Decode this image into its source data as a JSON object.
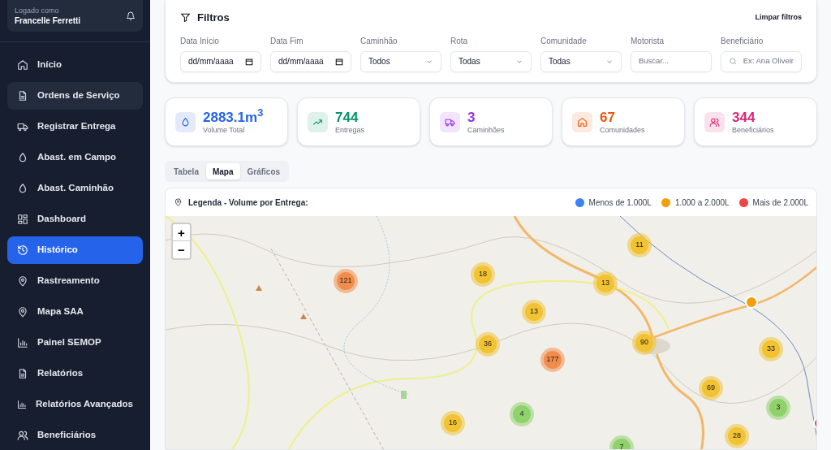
{
  "user": {
    "caption": "Logado como",
    "name": "Francelle Ferretti"
  },
  "nav": [
    {
      "label": "Início",
      "selected": false
    },
    {
      "label": "Ordens de Serviço",
      "selected": false,
      "hover": true
    },
    {
      "label": "Registrar Entrega",
      "selected": false
    },
    {
      "label": "Abast. em Campo",
      "selected": false
    },
    {
      "label": "Abast. Caminhão",
      "selected": false
    },
    {
      "label": "Dashboard",
      "selected": false
    },
    {
      "label": "Histórico",
      "selected": true
    },
    {
      "label": "Rastreamento",
      "selected": false
    },
    {
      "label": "Mapa SAA",
      "selected": false
    },
    {
      "label": "Painel SEMOP",
      "selected": false
    },
    {
      "label": "Relatórios",
      "selected": false
    },
    {
      "label": "Relatórios Avançados",
      "selected": false
    },
    {
      "label": "Beneficiários",
      "selected": false
    }
  ],
  "filters": {
    "title": "Filtros",
    "clear": "Limpar filtros",
    "fields": [
      {
        "label": "Data Início",
        "kind": "date",
        "value": "dd/mm/aaaa"
      },
      {
        "label": "Data Fim",
        "kind": "date",
        "value": "dd/mm/aaaa"
      },
      {
        "label": "Caminhão",
        "kind": "select",
        "value": "Todos"
      },
      {
        "label": "Rota",
        "kind": "select",
        "value": "Todas"
      },
      {
        "label": "Comunidade",
        "kind": "select",
        "value": "Todas"
      },
      {
        "label": "Motorista",
        "kind": "text",
        "placeholder": "Buscar..."
      },
      {
        "label": "Beneficiário",
        "kind": "search",
        "placeholder": "Ex: Ana Oliveir"
      }
    ]
  },
  "stats": [
    {
      "value": "2883.1m$^{3}$",
      "label": "Volume Total",
      "color": "#2563eb"
    },
    {
      "value": "744",
      "label": "Entregas",
      "color": "#059669"
    },
    {
      "value": "3",
      "label": "Caminhões",
      "color": "#9333ea"
    },
    {
      "value": "67",
      "label": "Comunidades",
      "color": "#ea580c"
    },
    {
      "value": "344",
      "label": "Beneficiários",
      "color": "#db2777"
    }
  ],
  "view_tabs": [
    {
      "label": "Tabela",
      "selected": false
    },
    {
      "label": "Mapa",
      "selected": true
    },
    {
      "label": "Gráficos",
      "selected": false
    }
  ],
  "legend": {
    "title": "Legenda - Volume por Entrega:",
    "items": [
      {
        "label": "Menos de 1.000L",
        "color": "#3b82f6"
      },
      {
        "label": "1.000 a 2.000L",
        "color": "#f59e0b"
      },
      {
        "label": "Mais de 2.000L",
        "color": "#ef4444"
      }
    ]
  },
  "map": {
    "zoom_in": "+",
    "zoom_out": "−",
    "clusters": [
      {
        "count": "11",
        "color": "#f1c232"
      },
      {
        "count": "121",
        "color": "#f28c4b"
      },
      {
        "count": "18",
        "color": "#f1c232"
      },
      {
        "count": "13",
        "color": "#f1c232"
      },
      {
        "count": "13",
        "color": "#f1c232"
      },
      {
        "count": "36",
        "color": "#f1c232"
      },
      {
        "count": "177",
        "color": "#f28c4b"
      },
      {
        "count": "90",
        "color": "#f1c232"
      },
      {
        "count": "33",
        "color": "#f1c232"
      },
      {
        "count": "69",
        "color": "#f1c232"
      },
      {
        "count": "3",
        "color": "#8fd16a"
      },
      {
        "count": "4",
        "color": "#8fd16a"
      },
      {
        "count": "16",
        "color": "#f1c232"
      },
      {
        "count": "28",
        "color": "#f1c232"
      },
      {
        "count": "7",
        "color": "#8fd16a"
      }
    ],
    "points": [
      {
        "color": "#f59e0b"
      },
      {
        "color": "#ef4444"
      }
    ]
  }
}
